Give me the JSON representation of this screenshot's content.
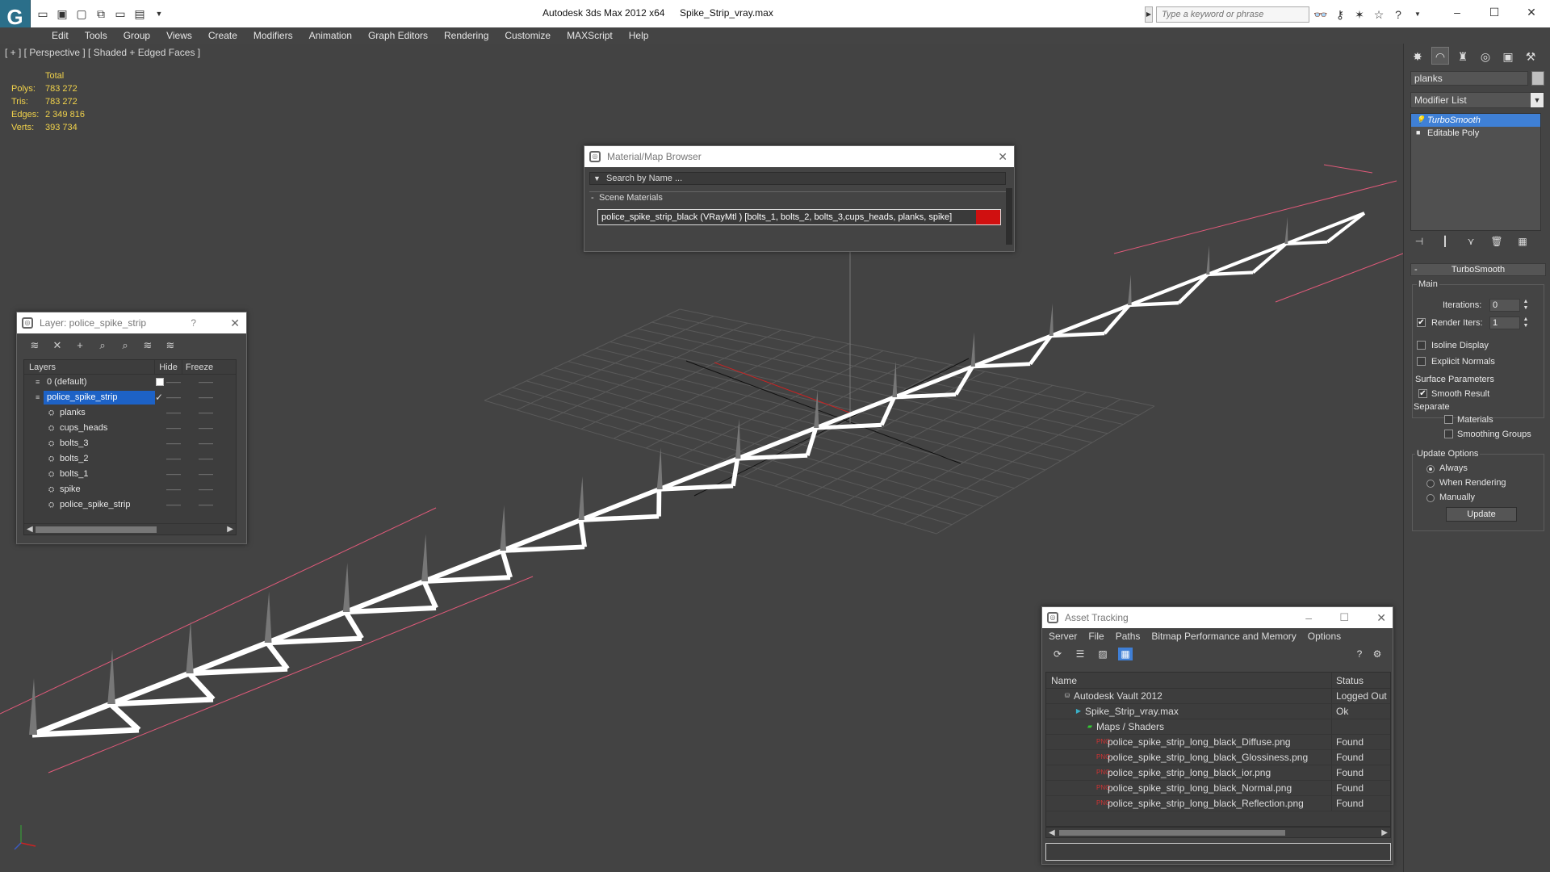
{
  "titlebar": {
    "logo": "G",
    "app_title": "Autodesk 3ds Max  2012 x64",
    "file_title": "Spike_Strip_vray.max",
    "search_placeholder": "Type a keyword or phrase",
    "qa_icons": [
      "open-icon",
      "save-icon",
      "new-icon",
      "undo-icon",
      "redo-icon",
      "project-icon"
    ],
    "win": {
      "minimize": "–",
      "maximize": "☐",
      "close": "✕"
    }
  },
  "menu": [
    "Edit",
    "Tools",
    "Group",
    "Views",
    "Create",
    "Modifiers",
    "Animation",
    "Graph Editors",
    "Rendering",
    "Customize",
    "MAXScript",
    "Help"
  ],
  "viewport": {
    "label": "[ + ] [ Perspective ] [ Shaded + Edged Faces ]",
    "stats": {
      "header": "Total",
      "rows": [
        {
          "k": "Polys:",
          "v": "783 272"
        },
        {
          "k": "Tris:",
          "v": "783 272"
        },
        {
          "k": "Edges:",
          "v": "2 349 816"
        },
        {
          "k": "Verts:",
          "v": "393 734"
        }
      ]
    },
    "colors": {
      "grid": "#5a5a5a",
      "bbox": "#e05a7a",
      "object": "#ffffff",
      "spike": "#777777",
      "axis_x": "#cc2222",
      "axis_y": "#111111"
    }
  },
  "command_panel": {
    "tabs": [
      "create-icon",
      "modify-icon",
      "hierarchy-icon",
      "motion-icon",
      "display-icon",
      "utilities-icon"
    ],
    "object_name": "planks",
    "modifier_list": "Modifier List",
    "stack": [
      {
        "name": "TurboSmooth",
        "selected": true
      },
      {
        "name": "Editable Poly",
        "selected": false
      }
    ],
    "turbosmooth": {
      "title": "TurboSmooth",
      "main": "Main",
      "iterations_label": "Iterations:",
      "iterations_value": "0",
      "render_iters_label": "Render Iters:",
      "render_iters_value": "1",
      "render_iters_checked": true,
      "isoline_label": "Isoline Display",
      "isoline_checked": false,
      "explicit_label": "Explicit Normals",
      "explicit_checked": false,
      "surface_title": "Surface Parameters",
      "smooth_result_label": "Smooth Result",
      "smooth_result_checked": true,
      "separate_label": "Separate",
      "materials_label": "Materials",
      "smoothing_groups_label": "Smoothing Groups",
      "update_title": "Update Options",
      "always_label": "Always",
      "when_rendering_label": "When Rendering",
      "manually_label": "Manually",
      "update_button": "Update"
    }
  },
  "material_browser": {
    "title": "Material/Map Browser",
    "search_placeholder": "Search by Name ...",
    "section": "Scene Materials",
    "item": "police_spike_strip_black  (VRayMtl ) [bolts_1, bolts_2, bolts_3,cups_heads, planks, spike]",
    "swatch_color": "#d01010"
  },
  "layer_dialog": {
    "title": "Layer: police_spike_strip",
    "help": "?",
    "col_layers": "Layers",
    "col_hide": "Hide",
    "col_freeze": "Freeze",
    "rows": [
      {
        "name": "0 (default)",
        "level": 0,
        "selected": false,
        "current": true
      },
      {
        "name": "police_spike_strip",
        "level": 0,
        "selected": true,
        "current": false
      },
      {
        "name": "planks",
        "level": 1,
        "selected": false,
        "current": false
      },
      {
        "name": "cups_heads",
        "level": 1,
        "selected": false,
        "current": false
      },
      {
        "name": "bolts_3",
        "level": 1,
        "selected": false,
        "current": false
      },
      {
        "name": "bolts_2",
        "level": 1,
        "selected": false,
        "current": false
      },
      {
        "name": "bolts_1",
        "level": 1,
        "selected": false,
        "current": false
      },
      {
        "name": "spike",
        "level": 1,
        "selected": false,
        "current": false
      },
      {
        "name": "police_spike_strip",
        "level": 1,
        "selected": false,
        "current": false
      }
    ],
    "dash": "——"
  },
  "asset_tracking": {
    "title": "Asset Tracking",
    "menu": [
      "Server",
      "File",
      "Paths",
      "Bitmap Performance and Memory",
      "Options"
    ],
    "col_name": "Name",
    "col_status": "Status",
    "rows": [
      {
        "name": "Autodesk Vault 2012",
        "status": "Logged Out",
        "level": 0,
        "icon": "vault-icon"
      },
      {
        "name": "Spike_Strip_vray.max",
        "status": "Ok",
        "level": 1,
        "icon": "max-file-icon"
      },
      {
        "name": "Maps / Shaders",
        "status": "",
        "level": 2,
        "icon": "maps-icon"
      },
      {
        "name": "police_spike_strip_long_black_Diffuse.png",
        "status": "Found",
        "level": 3,
        "icon": "png-icon"
      },
      {
        "name": "police_spike_strip_long_black_Glossiness.png",
        "status": "Found",
        "level": 3,
        "icon": "png-icon"
      },
      {
        "name": "police_spike_strip_long_black_ior.png",
        "status": "Found",
        "level": 3,
        "icon": "png-icon"
      },
      {
        "name": "police_spike_strip_long_black_Normal.png",
        "status": "Found",
        "level": 3,
        "icon": "png-icon"
      },
      {
        "name": "police_spike_strip_long_black_Reflection.png",
        "status": "Found",
        "level": 3,
        "icon": "png-icon"
      }
    ]
  }
}
